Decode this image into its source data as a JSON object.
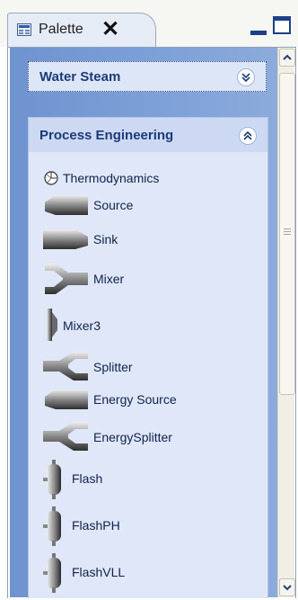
{
  "tab": {
    "title": "Palette",
    "close_glyph": "✕"
  },
  "drawers": [
    {
      "label": "Water Steam",
      "state": "collapsed",
      "chevron": "double-down"
    },
    {
      "label": "Process Engineering",
      "state": "expanded",
      "chevron": "double-up"
    }
  ],
  "items": [
    {
      "label": "Thermodynamics",
      "icon": "thermodynamics-icon"
    },
    {
      "label": "Source",
      "icon": "source-icon"
    },
    {
      "label": "Sink",
      "icon": "sink-icon"
    },
    {
      "label": "Mixer",
      "icon": "mixer-icon"
    },
    {
      "label": "Mixer3",
      "icon": "mixer3-icon"
    },
    {
      "label": "Splitter",
      "icon": "splitter-icon"
    },
    {
      "label": "Energy Source",
      "icon": "energy-source-icon"
    },
    {
      "label": "EnergySplitter",
      "icon": "energy-splitter-icon"
    },
    {
      "label": "Flash",
      "icon": "flash-icon"
    },
    {
      "label": "FlashPH",
      "icon": "flashph-icon"
    },
    {
      "label": "FlashVLL",
      "icon": "flashvll-icon"
    }
  ],
  "colors": {
    "palette_bg": "#7ea1d8",
    "drawer_bg": "#dfe7f8",
    "drawer_label": "#1b3b7a"
  }
}
